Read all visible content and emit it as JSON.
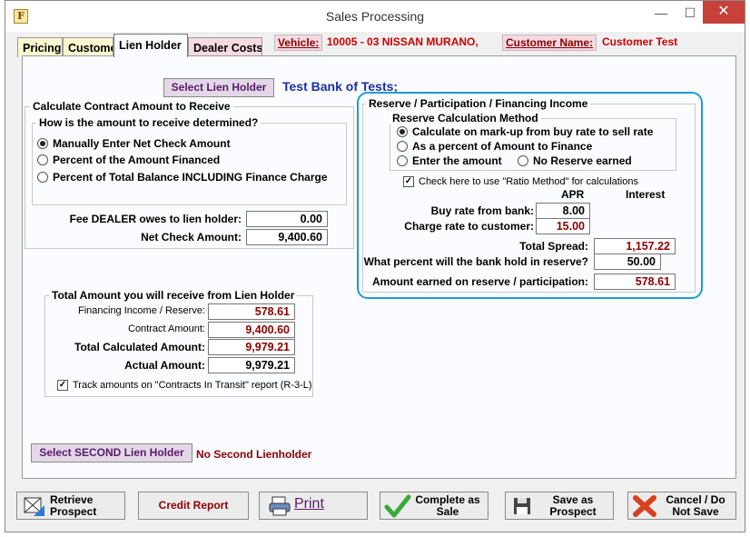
{
  "window": {
    "title": "Sales Processing",
    "app_icon_glyph": "F",
    "minimize_glyph": "—",
    "maximize_glyph": "☐",
    "close_glyph": "✕"
  },
  "tabs": [
    {
      "label": "Pricing",
      "active": false
    },
    {
      "label": "Customer",
      "active": false
    },
    {
      "label": "Lien Holder",
      "active": true
    },
    {
      "label": "Dealer Costs",
      "active": false
    }
  ],
  "header": {
    "vehicle_label": "Vehicle:",
    "vehicle_value": "10005 - 03 NISSAN MURANO,",
    "customer_label": "Customer Name:",
    "customer_value": "Customer Test"
  },
  "lien_holder": {
    "select_button": "Select Lien Holder",
    "name": "Test Bank of Tests;"
  },
  "contract_amount": {
    "group_title": "Calculate Contract Amount to Receive",
    "question_title": "How is the amount to receive determined?",
    "options": [
      {
        "label": "Manually Enter Net Check Amount",
        "selected": true
      },
      {
        "label": "Percent of the Amount Financed",
        "selected": false
      },
      {
        "label": "Percent of Total Balance INCLUDING Finance Charge",
        "selected": false
      }
    ],
    "fee_label": "Fee DEALER owes to lien holder:",
    "fee_value": "0.00",
    "net_check_label": "Net Check Amount:",
    "net_check_value": "9,400.60"
  },
  "reserve": {
    "group_title": "Reserve / Participation / Financing Income",
    "method_title": "Reserve Calculation Method",
    "options": [
      {
        "label": "Calculate on mark-up from buy rate to sell rate",
        "selected": true
      },
      {
        "label": "As a percent of Amount to Finance",
        "selected": false
      },
      {
        "label": "Enter the amount",
        "selected": false
      },
      {
        "label": "No Reserve earned",
        "selected": false
      }
    ],
    "ratio_check_label": "Check here to use \"Ratio Method\" for calculations",
    "ratio_checked": true,
    "apr_header": "APR",
    "interest_header": "Interest",
    "buy_rate_label": "Buy rate from bank:",
    "buy_rate_value": "8.00",
    "charge_rate_label": "Charge rate to customer:",
    "charge_rate_value": "15.00",
    "total_spread_label": "Total Spread:",
    "total_spread_value": "1,157.22",
    "bank_hold_label": "What percent will the bank hold in reserve?",
    "bank_hold_value": "50.00",
    "earned_label": "Amount earned on reserve / participation:",
    "earned_value": "578.61"
  },
  "total_receive": {
    "group_title": "Total Amount you will receive from Lien Holder",
    "financing_income_label": "Financing Income / Reserve:",
    "financing_income_value": "578.61",
    "contract_amount_label": "Contract Amount:",
    "contract_amount_value": "9,400.60",
    "total_calculated_label": "Total Calculated Amount:",
    "total_calculated_value": "9,979.21",
    "actual_label": "Actual Amount:",
    "actual_value": "9,979.21",
    "track_label": "Track amounts on \"Contracts In Transit\" report (R-3-L)",
    "track_checked": true
  },
  "second_lien": {
    "select_button": "Select SECOND Lien Holder",
    "status": "No Second Lienholder"
  },
  "bottom_buttons": {
    "retrieve": "Retrieve Prospect",
    "credit_report": "Credit Report",
    "print": "Print",
    "complete": "Complete as Sale",
    "save_prospect": "Save as Prospect",
    "cancel": "Cancel / Do Not Save"
  },
  "colors": {
    "accent_blue": "#1e9bd6",
    "label_dark_red": "#8b0000",
    "lien_name_blue": "#1a2fa0",
    "tab_pink": "#f7d9e2",
    "tab_yellow": "#fbf7d0",
    "red_label": "#cc0000"
  }
}
